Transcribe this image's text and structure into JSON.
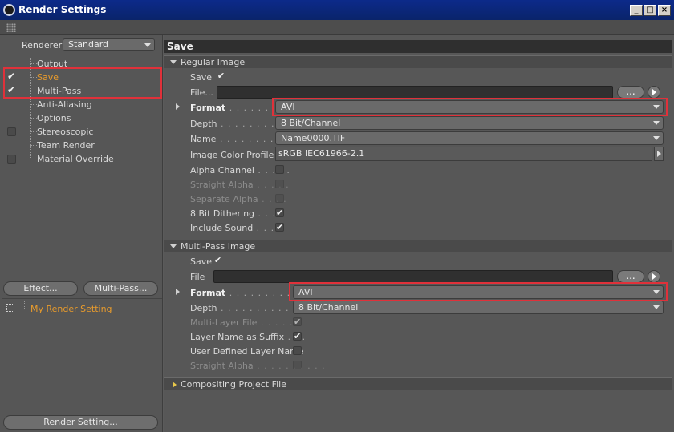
{
  "window": {
    "title": "Render Settings"
  },
  "left": {
    "renderer_label": "Renderer",
    "renderer_value": "Standard",
    "tree": [
      {
        "label": "Output",
        "checked": false,
        "has_box": false
      },
      {
        "label": "Save",
        "checked": true,
        "has_box": false
      },
      {
        "label": "Multi-Pass",
        "checked": true,
        "has_box": false
      },
      {
        "label": "Anti-Aliasing",
        "checked": false,
        "has_box": false
      },
      {
        "label": "Options",
        "checked": false,
        "has_box": false
      },
      {
        "label": "Stereoscopic",
        "checked": false,
        "has_box": true
      },
      {
        "label": "Team Render",
        "checked": false,
        "has_box": false
      },
      {
        "label": "Material Override",
        "checked": false,
        "has_box": true
      }
    ],
    "effect_button": "Effect...",
    "multipass_button": "Multi-Pass...",
    "render_setting_item": "My Render Setting",
    "render_setting_button": "Render Setting..."
  },
  "right": {
    "title": "Save",
    "regular": {
      "header": "Regular Image",
      "save_label": "Save",
      "file_label": "File...",
      "format_label": "Format",
      "format_value": "AVI",
      "depth_label": "Depth",
      "depth_value": "8 Bit/Channel",
      "name_label": "Name",
      "name_value": "Name0000.TIF",
      "profile_label": "Image Color Profile",
      "profile_value": "sRGB IEC61966-2.1",
      "alpha_label": "Alpha Channel",
      "straight_label": "Straight Alpha",
      "separate_label": "Separate Alpha",
      "dither_label": "8 Bit Dithering",
      "sound_label": "Include Sound",
      "browse": "..."
    },
    "multipass": {
      "header": "Multi-Pass Image",
      "save_label": "Save",
      "file_label": "File",
      "format_label": "Format",
      "format_value": "AVI",
      "depth_label": "Depth",
      "depth_value": "8 Bit/Channel",
      "mlfile_label": "Multi-Layer File",
      "layername_label": "Layer Name as Suffix",
      "userdef_label": "User Defined Layer Name",
      "straight_label": "Straight Alpha",
      "browse": "..."
    },
    "compositing": {
      "header": "Compositing Project File"
    }
  },
  "colors": {
    "highlight": "#e89b2c",
    "annotation": "#e0313a"
  }
}
